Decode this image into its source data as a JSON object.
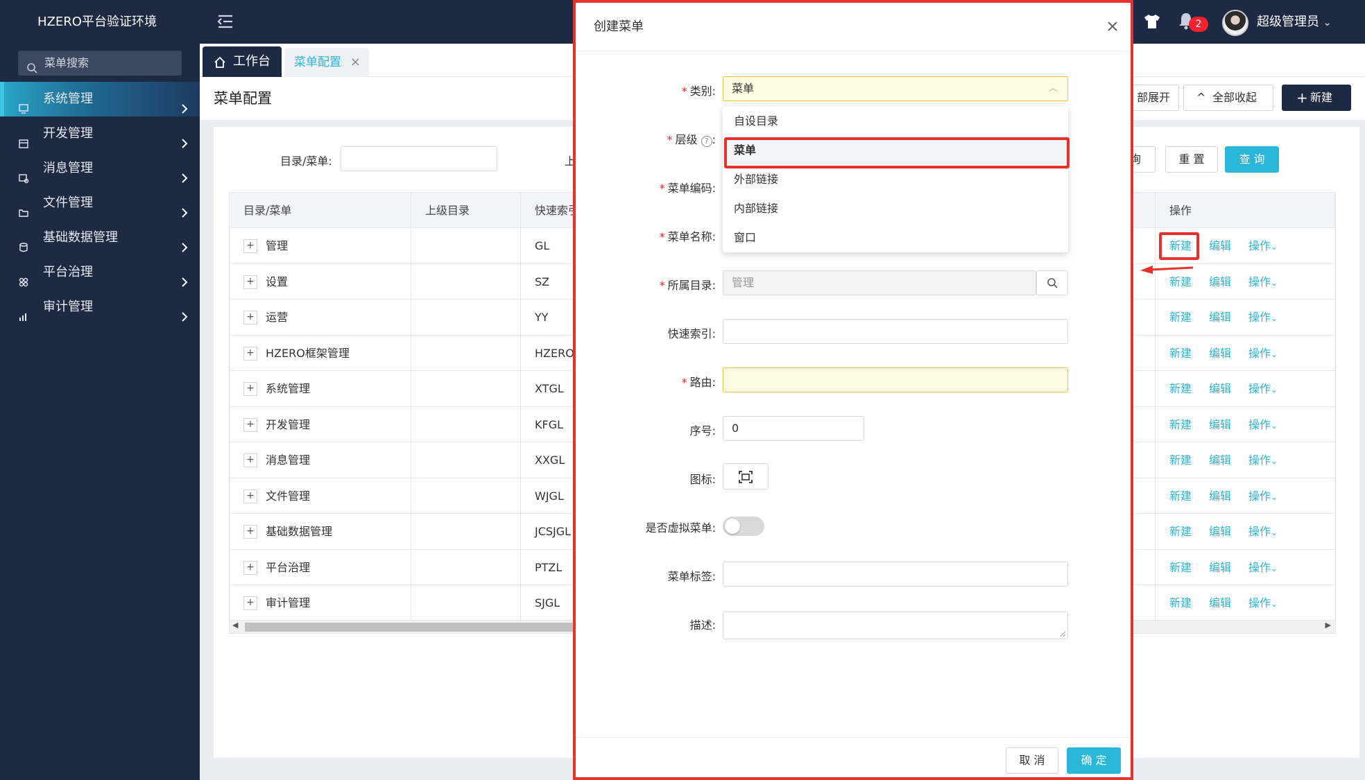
{
  "app": {
    "title": "HZERO平台验证环境"
  },
  "header": {
    "notification_count": "2",
    "username": "超级管理员"
  },
  "sidebar": {
    "search_placeholder": "菜单搜索",
    "items": [
      {
        "label": "系统管理",
        "active": true
      },
      {
        "label": "开发管理"
      },
      {
        "label": "消息管理"
      },
      {
        "label": "文件管理"
      },
      {
        "label": "基础数据管理"
      },
      {
        "label": "平台治理"
      },
      {
        "label": "审计管理"
      }
    ]
  },
  "tabs": {
    "workbench": "工作台",
    "menu_config": "菜单配置"
  },
  "page": {
    "title": "菜单配置",
    "expand_all": "部展开",
    "collapse_all": "全部收起",
    "new": "新建",
    "filter_label": "目录/菜单:",
    "filter_label_2": "上",
    "query_partial": "询",
    "reset": "重 置",
    "query": "查 询"
  },
  "table": {
    "headers": [
      "目录/菜单",
      "上级目录",
      "快速索引",
      "操作"
    ],
    "rows": [
      {
        "name": "管理",
        "parent": "",
        "code": "GL"
      },
      {
        "name": "设置",
        "parent": "",
        "code": "SZ"
      },
      {
        "name": "运营",
        "parent": "",
        "code": "YY"
      },
      {
        "name": "HZERO框架管理",
        "parent": "",
        "code": "HZERO"
      },
      {
        "name": "系统管理",
        "parent": "",
        "code": "XTGL"
      },
      {
        "name": "开发管理",
        "parent": "",
        "code": "KFGL"
      },
      {
        "name": "消息管理",
        "parent": "",
        "code": "XXGL"
      },
      {
        "name": "文件管理",
        "parent": "",
        "code": "WJGL"
      },
      {
        "name": "基础数据管理",
        "parent": "",
        "code": "JCSJGL"
      },
      {
        "name": "平台治理",
        "parent": "",
        "code": "PTZL"
      },
      {
        "name": "审计管理",
        "parent": "",
        "code": "SJGL"
      }
    ],
    "action_new": "新建",
    "action_edit": "编辑",
    "action_more": "操作"
  },
  "modal": {
    "title": "创建菜单",
    "labels": {
      "category": "类别:",
      "level": "层级",
      "level_colon": ":",
      "code": "菜单编码:",
      "name": "菜单名称:",
      "parent_dir": "所属目录:",
      "quick_index": "快速索引:",
      "route": "路由:",
      "order": "序号:",
      "icon": "图标:",
      "virtual": "是否虚拟菜单:",
      "tags": "菜单标签:",
      "description": "描述:"
    },
    "values": {
      "category": "菜单",
      "parent_dir": "管理",
      "order": "0",
      "virtual": false
    },
    "category_options": [
      "自设目录",
      "菜单",
      "外部链接",
      "内部链接",
      "窗口"
    ],
    "cancel": "取 消",
    "ok": "确 定"
  },
  "colors": {
    "accent": "#29b6d8",
    "navy": "#1d2a44",
    "highlight": "#e8302c"
  }
}
